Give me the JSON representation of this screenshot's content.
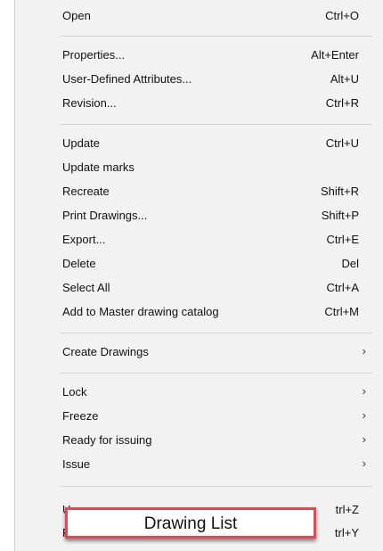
{
  "menu": {
    "items": [
      {
        "label": "Open",
        "shortcut": "Ctrl+O"
      },
      {
        "label": "Properties...",
        "shortcut": "Alt+Enter"
      },
      {
        "label": "User-Defined Attributes...",
        "shortcut": "Alt+U"
      },
      {
        "label": "Revision...",
        "shortcut": "Ctrl+R"
      },
      {
        "label": "Update",
        "shortcut": "Ctrl+U"
      },
      {
        "label": "Update marks",
        "shortcut": ""
      },
      {
        "label": "Recreate",
        "shortcut": "Shift+R"
      },
      {
        "label": "Print Drawings...",
        "shortcut": "Shift+P"
      },
      {
        "label": "Export...",
        "shortcut": "Ctrl+E"
      },
      {
        "label": "Delete",
        "shortcut": "Del"
      },
      {
        "label": "Select All",
        "shortcut": "Ctrl+A"
      },
      {
        "label": "Add to Master drawing catalog",
        "shortcut": "Ctrl+M"
      },
      {
        "label": "Create Drawings",
        "submenu": true
      },
      {
        "label": "Lock",
        "submenu": true
      },
      {
        "label": "Freeze",
        "submenu": true
      },
      {
        "label": "Ready for issuing",
        "submenu": true
      },
      {
        "label": "Issue",
        "submenu": true
      }
    ],
    "partial_items": [
      {
        "label_fragment": "U",
        "shortcut_fragment": "trl+Z"
      },
      {
        "label_fragment": "F",
        "shortcut_fragment": "trl+Y"
      }
    ],
    "submenu_arrow": "›"
  },
  "popup": {
    "label": "Drawing List",
    "border_color": "#e8474f"
  }
}
